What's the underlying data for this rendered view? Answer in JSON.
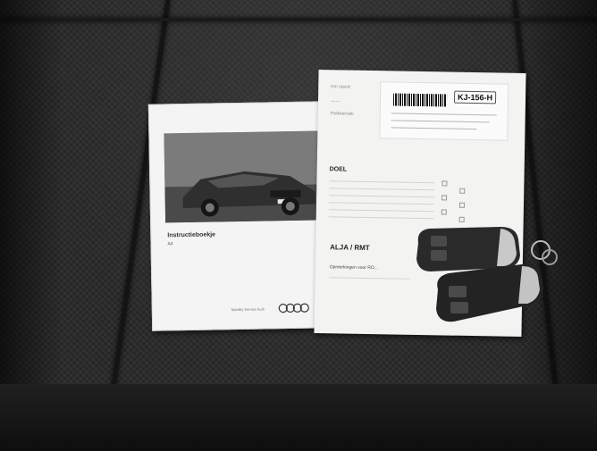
{
  "manual": {
    "title": "Instructieboekje",
    "model": "A4",
    "footer": "Mobility Service Audi",
    "brand_rings": "audi-rings-logo"
  },
  "paper": {
    "plate": "KJ-156-H",
    "kmstand_label": "Km stand:",
    "parkeervak_label": "Parkeervak:",
    "doel_label": "DOEL",
    "alja_text": "ALJA / RMT",
    "opmerkingen_label": "Opmerkingen voor RO..."
  },
  "colors": {
    "seat_fabric": "#262626",
    "paper": "#f3f3f1",
    "manual_cover": "#f4f4f4",
    "key_body": "#2a2a2a",
    "key_trim": "#c9c9c9"
  }
}
